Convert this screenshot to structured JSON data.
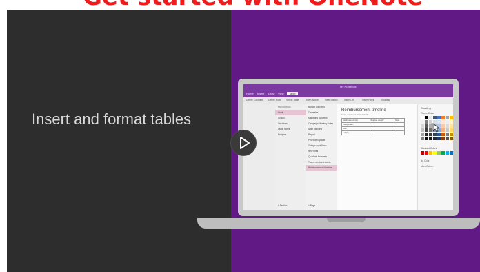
{
  "top_title": "Get started with OneNote",
  "headline": "Insert and format tables",
  "colors": {
    "left_bg": "#2d2d2d",
    "right_bg": "#601985",
    "accent": "#7b3aa1",
    "title_red": "#ee1c1c"
  },
  "window_title": "My Notebook",
  "ribbon_tabs": [
    "Home",
    "Insert",
    "Draw",
    "View",
    "Table"
  ],
  "active_tab": "Table",
  "ribbon_commands": [
    "Delete Columns",
    "Delete Rows",
    "Select Table",
    "Insert Above",
    "Insert Below",
    "Insert Left",
    "Insert Right",
    "Shading"
  ],
  "notebook": {
    "header": "My Notebook",
    "sections": [
      "Work",
      "School",
      "Vacations",
      "Quick Notes",
      "Recipes"
    ],
    "add_section": "+ Section"
  },
  "pages": {
    "items": [
      "Budget concerns",
      "Timesales",
      "Marketing concepts",
      "Campaign Meeting Notes",
      "Agile planning",
      "Payroll",
      "Prio team update",
      "Today's work flows",
      "New hires",
      "Quarterly forecasts",
      "Travel reimbursements",
      "Reimbursement timeline"
    ],
    "add_page": "+ Page",
    "selected": "Reimbursement timeline"
  },
  "note": {
    "title": "Reimbursement timeline",
    "date": "Friday, October 13, 2017    7:19 PM",
    "table": [
      [
        "Reimbursement item",
        "Requires receipt?",
        "Notes"
      ],
      [
        "Transportation",
        "",
        ""
      ],
      [
        "Food",
        "",
        ""
      ],
      [
        "Lodging",
        "",
        ""
      ]
    ]
  },
  "shading_pane": {
    "title": "Shading",
    "theme_label": "Theme Colors",
    "standard_label": "Standard Colors",
    "no_color": "No Color",
    "more_colors": "More Colors..."
  },
  "play_icon": "play-icon"
}
